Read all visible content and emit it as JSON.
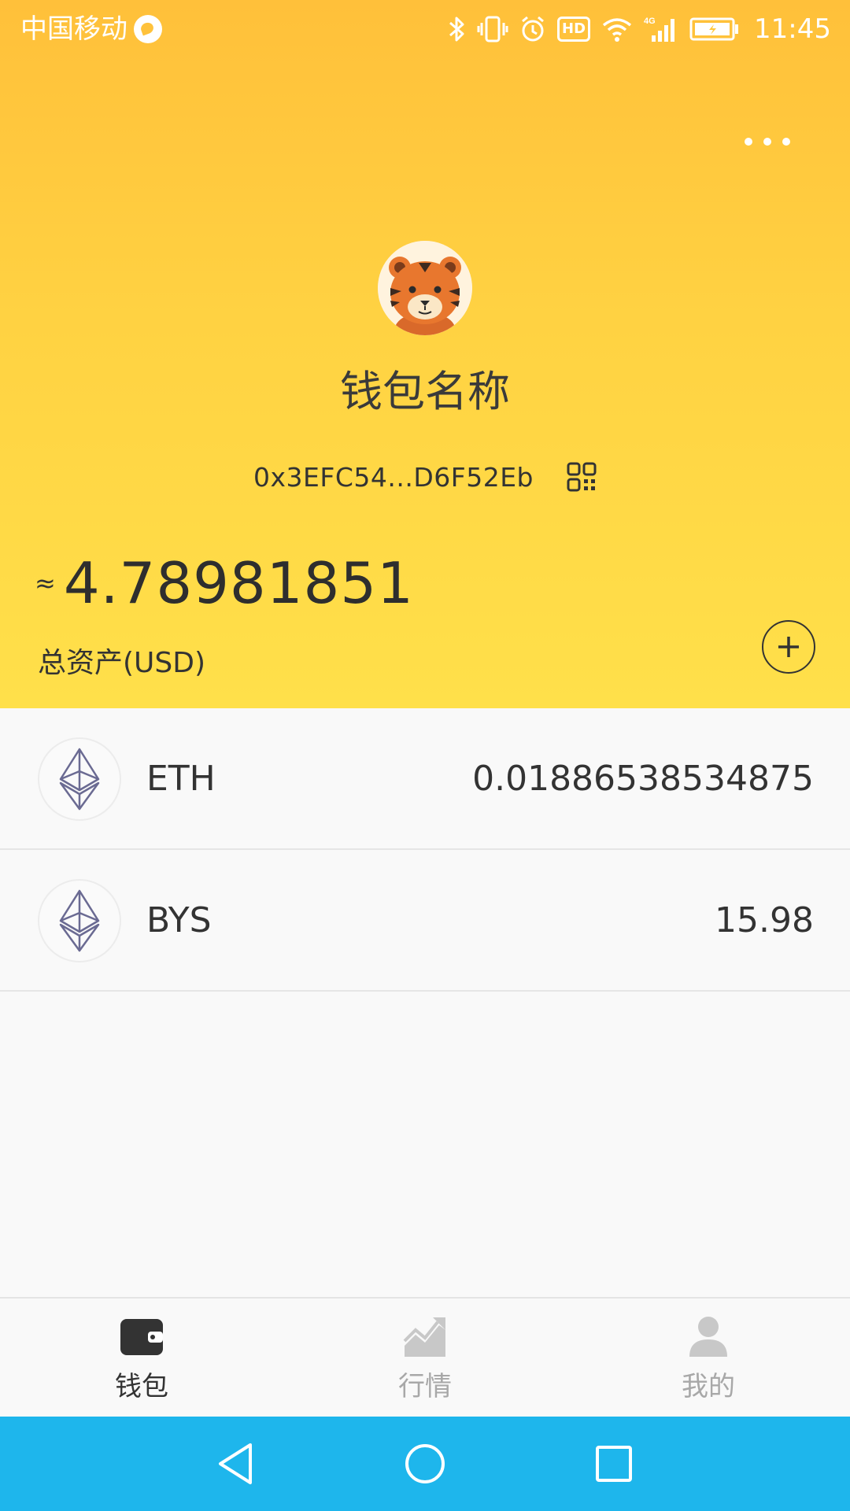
{
  "status_bar": {
    "carrier": "中国移动",
    "network_type": "4G",
    "hd_label": "HD",
    "time": "11:45",
    "icons": [
      "bluetooth-icon",
      "vibrate-icon",
      "alarm-icon",
      "hd-icon",
      "wifi-icon",
      "signal-icon",
      "battery-icon"
    ]
  },
  "header": {
    "menu_icon": "more-dots-icon",
    "avatar_icon": "tiger-avatar",
    "wallet_name": "钱包名称",
    "address": "0x3EFC54...D6F52Eb",
    "qr_icon": "qr-code-icon",
    "approx_symbol": "≈",
    "total_balance": "4.78981851",
    "total_label": "总资产(USD)",
    "add_icon": "plus-circle-icon"
  },
  "tokens": [
    {
      "symbol": "ETH",
      "balance": "0.01886538534875",
      "icon": "ethereum-icon"
    },
    {
      "symbol": "BYS",
      "balance": "15.98",
      "icon": "ethereum-icon"
    }
  ],
  "tab_bar": {
    "items": [
      {
        "label": "钱包",
        "icon": "wallet-icon",
        "active": true
      },
      {
        "label": "行情",
        "icon": "market-chart-icon",
        "active": false
      },
      {
        "label": "我的",
        "icon": "profile-icon",
        "active": false
      }
    ]
  },
  "nav_bar": {
    "buttons": [
      "back-triangle-icon",
      "home-circle-icon",
      "recents-square-icon"
    ]
  },
  "colors": {
    "header_top": "#ffc03a",
    "header_bottom": "#ffe04a",
    "nav_bar": "#1eb6ec",
    "active_tab": "#333333",
    "inactive_tab": "#a8a8a8"
  }
}
